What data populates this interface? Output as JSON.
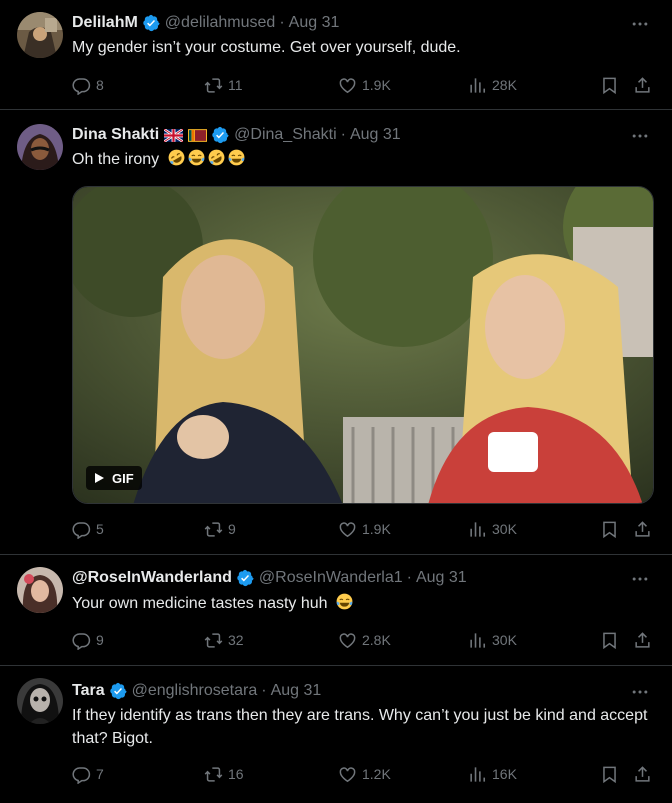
{
  "tweets": [
    {
      "display_name": "DelilahM",
      "handle": "@delilahmused",
      "date": "Aug 31",
      "text": "My gender isn’t your costume. Get over yourself, dude.",
      "replies": "8",
      "retweets": "11",
      "likes": "1.9K",
      "views": "28K"
    },
    {
      "display_name": "Dina Shakti",
      "handle": "@Dina_Shakti",
      "date": "Aug 31",
      "text": "Oh the irony",
      "emojis": [
        "rolling-laughing",
        "tears-of-joy",
        "rolling-laughing",
        "tears-of-joy"
      ],
      "media_badge": "GIF",
      "replies": "5",
      "retweets": "9",
      "likes": "1.9K",
      "views": "30K"
    },
    {
      "display_name": "@RoseInWanderland",
      "handle": "@RoseInWanderla1",
      "date": "Aug 31",
      "text": "Your own medicine tastes nasty huh",
      "emojis": [
        "tears-of-joy"
      ],
      "replies": "9",
      "retweets": "32",
      "likes": "2.8K",
      "views": "30K"
    },
    {
      "display_name": "Tara",
      "handle": "@englishrosetara",
      "date": "Aug 31",
      "text": "If they identify as trans then they are trans. Why can’t you just be kind and accept that? Bigot.",
      "replies": "7",
      "retweets": "16",
      "likes": "1.2K",
      "views": "16K"
    }
  ],
  "colors": {
    "background": "#000000",
    "text": "#e7e9ea",
    "muted": "#71767b",
    "verified": "#1d9bf0",
    "divider": "#2f3336"
  }
}
